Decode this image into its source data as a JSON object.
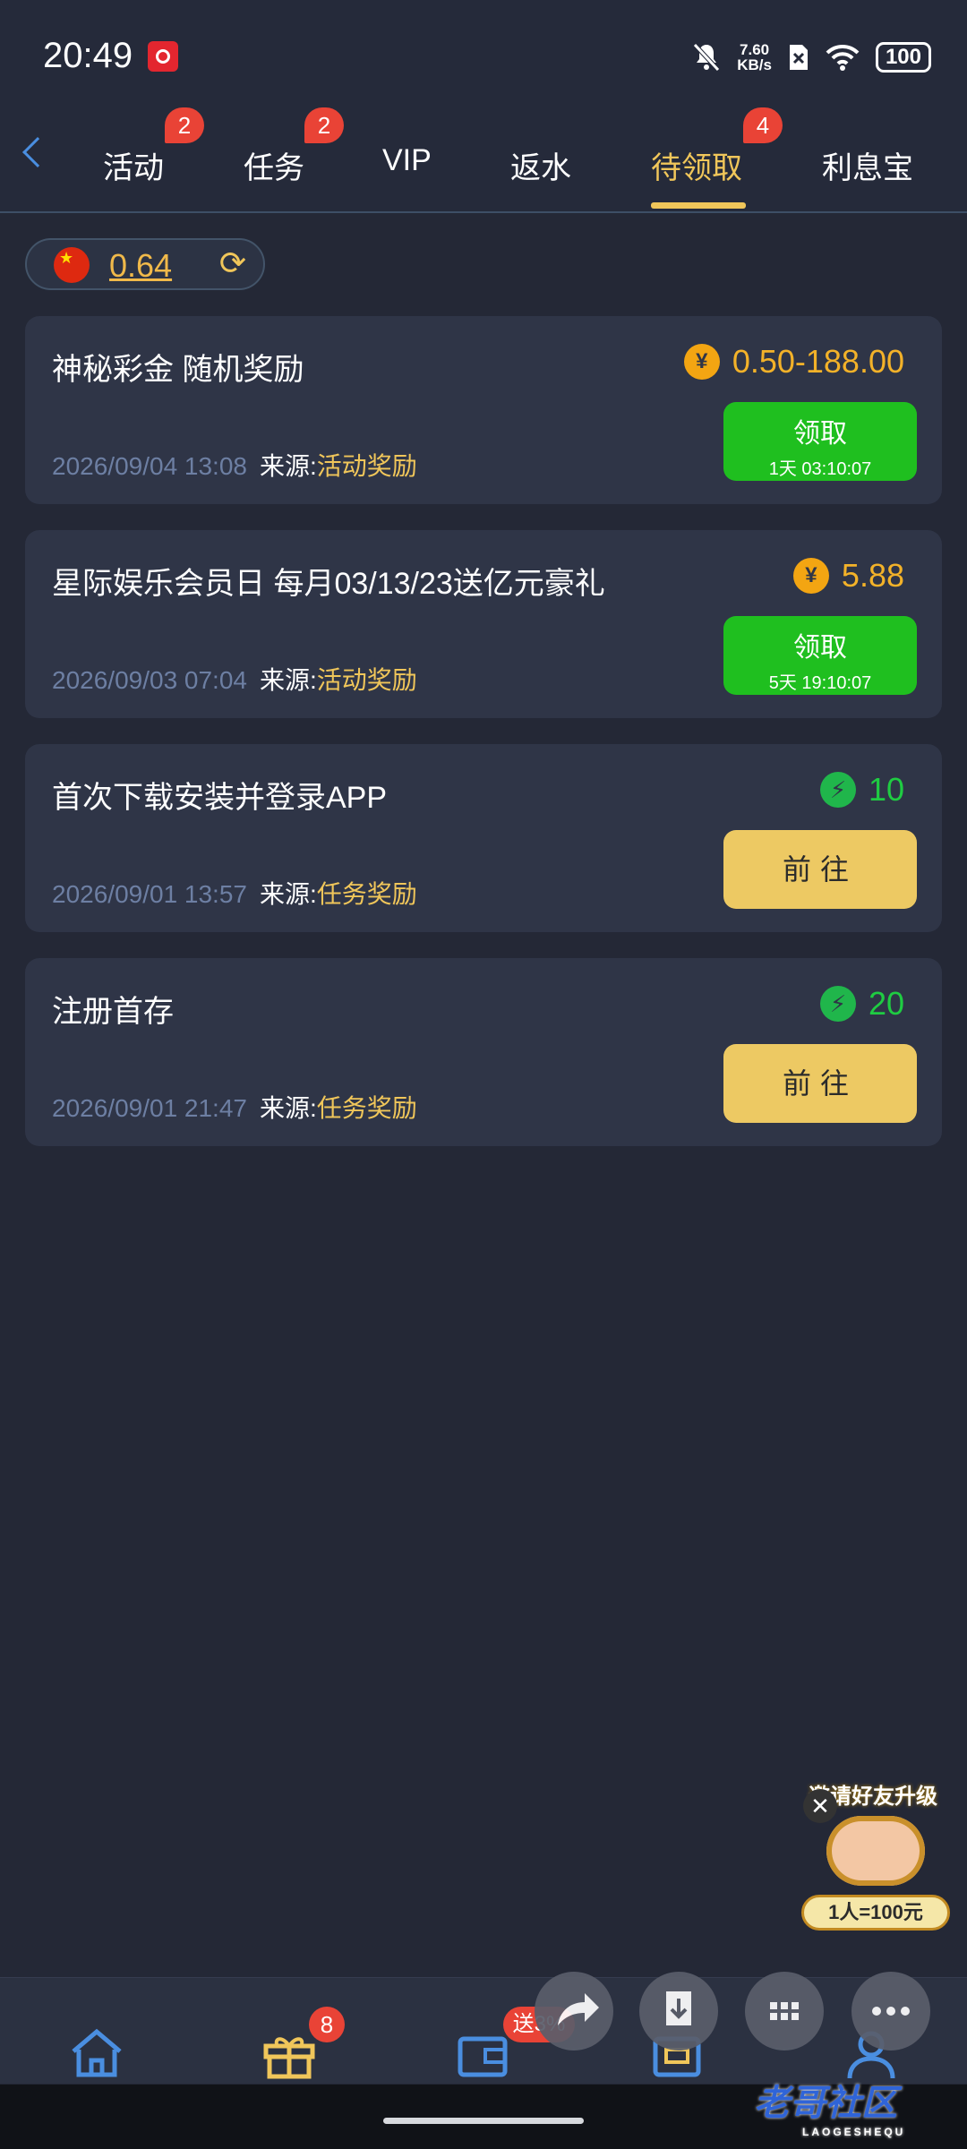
{
  "status_bar": {
    "time": "20:49",
    "speed_value": "7.60",
    "speed_unit": "KB/s",
    "battery": "100"
  },
  "tabs": [
    {
      "label": "活动",
      "badge": "2"
    },
    {
      "label": "任务",
      "badge": "2"
    },
    {
      "label": "VIP",
      "badge": ""
    },
    {
      "label": "返水",
      "badge": ""
    },
    {
      "label": "待领取",
      "badge": "4",
      "active": true
    },
    {
      "label": "利息宝",
      "badge": ""
    }
  ],
  "balance": {
    "value": "0.64"
  },
  "source_label": "来源:",
  "rewards": [
    {
      "title": "神秘彩金 随机奖励",
      "amount": "0.50-188.00",
      "icon": "coin-icon",
      "date": "2026/09/04 13:08",
      "source": "活动奖励",
      "button": "领取",
      "countdown": "1天 03:10:07"
    },
    {
      "title": "星际娱乐会员日 每月03/13/23送亿元豪礼",
      "amount": "5.88",
      "icon": "coin-icon",
      "date": "2026/09/03 07:04",
      "source": "活动奖励",
      "button": "领取",
      "countdown": "5天 19:10:07"
    },
    {
      "title": "首次下载安装并登录APP",
      "amount": "10",
      "icon": "bolt-icon",
      "date": "2026/09/01 13:57",
      "source": "任务奖励",
      "button": "前往"
    },
    {
      "title": "注册首存",
      "amount": "20",
      "icon": "bolt-icon",
      "date": "2026/09/01 21:47",
      "source": "任务奖励",
      "button": "前往"
    }
  ],
  "promo": {
    "title": "邀请好友升级",
    "pill": "1人=100元"
  },
  "bottom_nav": [
    {
      "label": "首页",
      "badge": ""
    },
    {
      "label": "优惠",
      "badge": "8"
    },
    {
      "label": "存款",
      "badge": "送3%"
    },
    {
      "label": "提现",
      "badge": ""
    },
    {
      "label": "我的",
      "badge": ""
    }
  ],
  "watermark": {
    "text": "老哥社区",
    "sub": "LAOGESHEQU"
  },
  "colors": {
    "accent": "#f0c65a",
    "green": "#1fbf1f",
    "badge": "#e94336",
    "card": "#2f3547"
  }
}
